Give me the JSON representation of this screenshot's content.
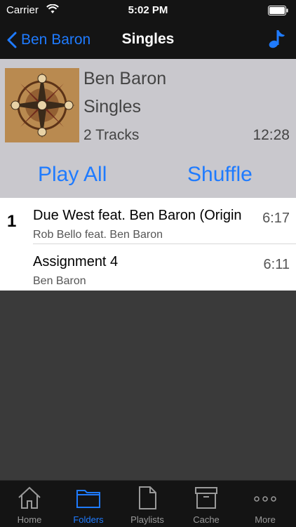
{
  "status": {
    "carrier": "Carrier",
    "time": "5:02 PM"
  },
  "nav": {
    "back_label": "Ben Baron",
    "title": "Singles"
  },
  "album": {
    "artist": "Ben Baron",
    "name": "Singles",
    "tracks": "2 Tracks",
    "duration": "12:28"
  },
  "actions": {
    "play_all": "Play All",
    "shuffle": "Shuffle"
  },
  "tracks": [
    {
      "number": "1",
      "title": "Due West feat. Ben Baron (Origin",
      "artist": "Rob Bello feat. Ben Baron",
      "duration": "6:17"
    },
    {
      "number": "",
      "title": "Assignment 4",
      "artist": "Ben Baron",
      "duration": "6:11"
    }
  ],
  "tabs": [
    {
      "label": "Home",
      "icon": "home-icon"
    },
    {
      "label": "Folders",
      "icon": "folder-icon",
      "active": true
    },
    {
      "label": "Playlists",
      "icon": "document-icon"
    },
    {
      "label": "Cache",
      "icon": "archive-icon"
    },
    {
      "label": "More",
      "icon": "more-icon"
    }
  ],
  "colors": {
    "accent": "#1f7bff",
    "bar_bg": "#141414",
    "header_bg": "#c9c8cd"
  }
}
